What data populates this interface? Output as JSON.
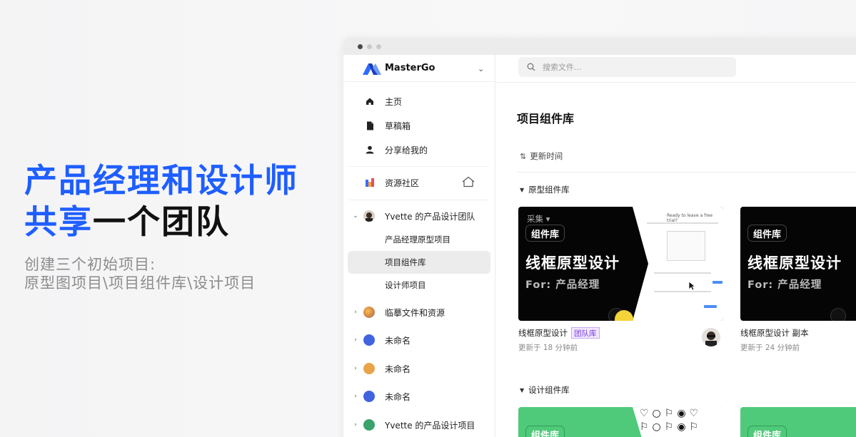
{
  "promo": {
    "headline_line1": "产品经理和设计师",
    "headline_line2_blue": "共享",
    "headline_line2_black": "一个团队",
    "sub_line1": "创建三个初始项目:",
    "sub_line2": "原型图项目\\项目组件库\\设计项目"
  },
  "app": {
    "brand": "MasterGo",
    "search_placeholder": "搜索文件...",
    "nav": [
      {
        "label": "主页",
        "icon": "home-icon"
      },
      {
        "label": "草稿箱",
        "icon": "draft-file-icon"
      },
      {
        "label": "分享给我的",
        "icon": "user-icon"
      },
      {
        "label": "资源社区",
        "icon": "community-icon"
      }
    ],
    "team": {
      "name": "Yvette 的产品设计团队",
      "projects": [
        "产品经理原型项目",
        "项目组件库",
        "设计师项目"
      ],
      "selected": "项目组件库"
    },
    "other_teams": [
      {
        "name": "临摹文件和资源",
        "color": "#d9843b"
      },
      {
        "name": "未命名",
        "color": "#4063e0"
      },
      {
        "name": "未命名",
        "color": "#e9a449"
      },
      {
        "name": "未命名",
        "color": "#4063e0"
      },
      {
        "name": "Yvette 的产品设计项目",
        "color": "#3aa26a"
      }
    ]
  },
  "main": {
    "title": "项目组件库",
    "sort_label": "更新时间",
    "sections": [
      {
        "name": "原型组件库",
        "cards": [
          {
            "tag": "组件库",
            "thumb_title": "线框原型设计",
            "thumb_subtitle": "For: 产品经理",
            "overlay": "采集",
            "mock_heading": "Ready to leave a free trial?",
            "name": "线框原型设计",
            "badge": "团队库",
            "updated": "更新于 18 分钟前"
          },
          {
            "tag": "组件库",
            "thumb_title": "线框原型设计",
            "thumb_subtitle": "For: 产品经理",
            "name": "线框原型设计 副本",
            "updated": "更新于 24 分钟前"
          }
        ]
      },
      {
        "name": "设计组件库",
        "cards": [
          {
            "tag": "组件库",
            "glyph_row1": "♡○⚐◉♡",
            "glyph_row2": "⚐○⚐◉⚐"
          },
          {
            "tag": "组件库"
          }
        ]
      }
    ]
  },
  "colors": {
    "accent": "#1f5eff",
    "green_card": "#4fca7a",
    "badge_purple": "#7a3fd6"
  }
}
